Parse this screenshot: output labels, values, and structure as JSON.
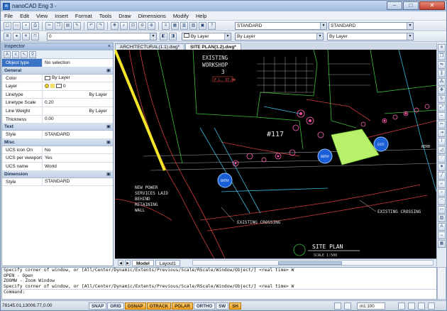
{
  "window": {
    "title": "nanoCAD Eng 3 -",
    "app_icon": "nanocad-logo-icon",
    "buttons": [
      "–",
      "□",
      "✕"
    ]
  },
  "menu": [
    "File",
    "Edit",
    "View",
    "Insert",
    "Format",
    "Tools",
    "Draw",
    "Dimensions",
    "Modify",
    "Help"
  ],
  "toolbar": {
    "text_style": "STANDARD",
    "dim_style": "STANDARD",
    "layer": "0",
    "color": "By Layer",
    "linetype": "By Layer",
    "lineweight": "By Layer"
  },
  "inspector": {
    "title": "Inspector",
    "close": "×",
    "object_type_label": "Object type",
    "object_type_value": "No selection",
    "categories": [
      {
        "name": "General",
        "rows": [
          {
            "name": "Color",
            "value": "By Layer"
          },
          {
            "name": "Layer",
            "value": "0"
          },
          {
            "name": "Linetype",
            "value": "By Layer"
          },
          {
            "name": "Linetype Scale",
            "value": "0.20"
          },
          {
            "name": "Line Weight",
            "value": "By Layer"
          },
          {
            "name": "Thickness",
            "value": "0.00"
          }
        ]
      },
      {
        "name": "Text",
        "rows": [
          {
            "name": "Style",
            "value": "STANDARD"
          }
        ]
      },
      {
        "name": "Misc",
        "rows": [
          {
            "name": "UCS icon On",
            "value": "No"
          },
          {
            "name": "UCS per viewport",
            "value": "Yes"
          },
          {
            "name": "UCS name",
            "value": "World"
          }
        ]
      },
      {
        "name": "Dimension",
        "rows": [
          {
            "name": "Style",
            "value": "STANDARD"
          }
        ]
      }
    ]
  },
  "doc_tabs": [
    "ARCHITECTURAL(1.1).dwg*",
    "SITE PLAN(1.2).dwg*"
  ],
  "layout_tabs": [
    "Model",
    "Layout1"
  ],
  "drawing": {
    "existing_workshop": [
      "EXISTING",
      "WORKSHOP",
      "3"
    ],
    "fl_label": "F.L. 37.0m",
    "lot_number": "#117",
    "new_power": [
      "NEW POWER",
      "SERVICES LAID",
      "BEHIND",
      "RETAINING",
      "WALL"
    ],
    "crossing_1": "EXISTING CROSSING",
    "crossing_2": "EXISTING CROSSING",
    "site_plan_title": "SITE PLAN",
    "site_plan_scale": "SCALE 1:500",
    "kerb": "KERB",
    "entry_1": "ENTRY",
    "entry_2": "ENTRY",
    "exit": "EXIT"
  },
  "command": {
    "lines": [
      "Specify corner of window, or [All/Center/Dynamic/Extents/Previous/Scale/RScale/Window/Object/] <real time> W",
      "OPEN - Open",
      "ZOOMW - Zoom Window",
      "Specify corner of window, or [All/Center/Dynamic/Extents/Previous/Scale/RScale/Window/Object/] <real time> W"
    ],
    "prompt": "Command:"
  },
  "status": {
    "coords": "78145.01,13006.77,0.00",
    "toggles": [
      {
        "label": "SNAP",
        "on": false
      },
      {
        "label": "GRID",
        "on": false
      },
      {
        "label": "OSNAP",
        "on": true
      },
      {
        "label": "OTRACK",
        "on": true
      },
      {
        "label": "POLAR",
        "on": true
      },
      {
        "label": "ORTHO",
        "on": false
      },
      {
        "label": "SW",
        "on": false
      },
      {
        "label": "SH",
        "on": true
      }
    ],
    "scale": "m1:100"
  },
  "colors": {
    "accent": "#3a72c4",
    "canvas": "#000000",
    "status_on": "#f0a020"
  }
}
